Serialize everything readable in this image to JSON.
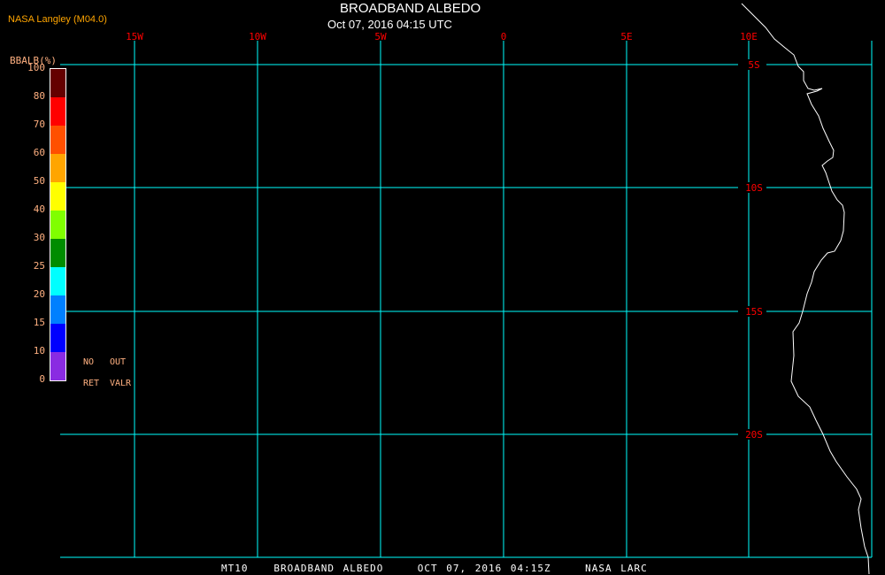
{
  "header": {
    "source": "NASA Langley (M04.0)",
    "title": "BROADBAND ALBEDO",
    "subtitle": "Oct 07, 2016 04:15 UTC"
  },
  "footer": {
    "text": "MT10   BROADBAND ALBEDO    OCT 07, 2016 04:15Z    NASA LARC"
  },
  "colorbar": {
    "title": "BBALB(%)",
    "labels": [
      "0",
      "10",
      "15",
      "20",
      "25",
      "30",
      "40",
      "50",
      "60",
      "70",
      "80",
      "100"
    ],
    "colors": [
      "#8a2be2",
      "#0000ff",
      "#0080ff",
      "#00ffff",
      "#008c00",
      "#80ff00",
      "#ffff00",
      "#ffa500",
      "#ff5000",
      "#ff0000",
      "#640000"
    ],
    "no_ret": [
      "NO",
      "RET"
    ],
    "out_valr": [
      "OUT",
      "VALR"
    ]
  },
  "map": {
    "grid_color": "#00ffff",
    "coast_color": "#ffffff",
    "label_color": "#ff0000",
    "lon_labels": [
      "15W",
      "10W",
      "5W",
      "0",
      "5E",
      "10E"
    ],
    "lat_labels": [
      "5S",
      "10S",
      "15S",
      "20S"
    ]
  }
}
